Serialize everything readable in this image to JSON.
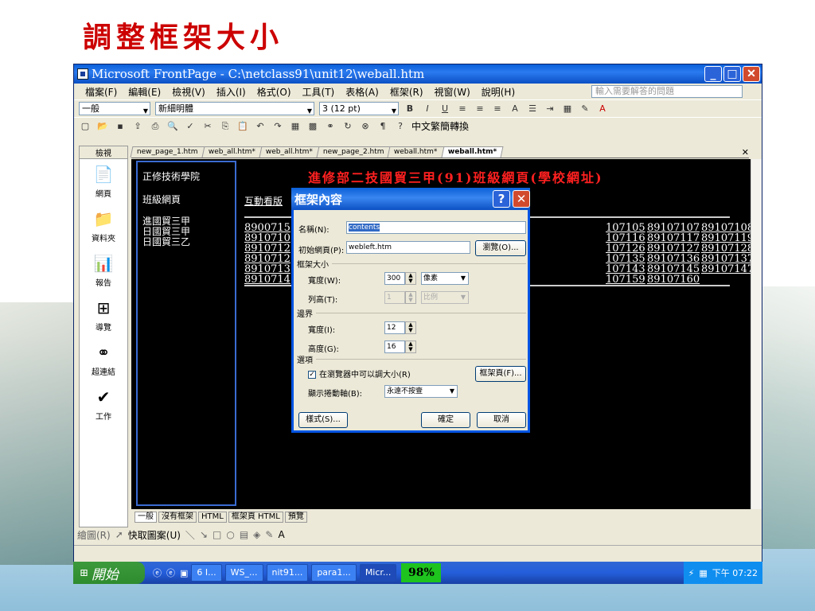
{
  "slide": {
    "title": "調整框架大小"
  },
  "window": {
    "title": "Microsoft FrontPage - C:\\netclass91\\unit12\\weball.htm"
  },
  "menu": {
    "items": [
      "檔案(F)",
      "編輯(E)",
      "檢視(V)",
      "插入(I)",
      "格式(O)",
      "工具(T)",
      "表格(A)",
      "框架(R)",
      "視窗(W)",
      "說明(H)"
    ],
    "help_placeholder": "輸入需要解答的問題"
  },
  "format_toolbar": {
    "style": "一般",
    "font": "新細明體",
    "size": "3 (12 pt)"
  },
  "std_toolbar": {
    "convert": "中文繁簡轉換"
  },
  "views": {
    "header": "檢視",
    "items": [
      "網頁",
      "資料夾",
      "報告",
      "導覽",
      "超連結",
      "工作"
    ]
  },
  "doc_tabs": [
    "new_page_1.htm",
    "web_all.htm*",
    "web_all.htm*",
    "new_page_2.htm",
    "weball.htm*",
    "weball.htm*"
  ],
  "page": {
    "left_links": [
      "正修技術學院",
      "班級網頁",
      "進國貿三甲",
      "日國貿三甲",
      "日國貿三乙"
    ],
    "heading": "進修部二技國貿三甲(91)班級網頁(學校網址)",
    "interactive_label": "互動看版",
    "ids_left": [
      "8900715",
      "8910710",
      "8910712",
      "8910712",
      "8910713",
      "8910714"
    ],
    "ids_c1": [
      "107105",
      "107116",
      "107126",
      "107135",
      "107143",
      "107159"
    ],
    "ids_c2": [
      "89107107",
      "89107117",
      "89107127",
      "89107136",
      "89107145",
      "89107160"
    ],
    "ids_c3": [
      "89107108",
      "89107119",
      "89107128",
      "89107137",
      "89107147",
      ""
    ]
  },
  "bottom_tabs": [
    "一般",
    "沒有框架",
    "HTML",
    "框架頁 HTML",
    "預覽"
  ],
  "drawing": {
    "draw": "繪圖(R)",
    "autoshapes": "快取圖案(U)"
  },
  "dialog": {
    "title": "框架內容",
    "name_label": "名稱(N):",
    "name_value": "contents",
    "page_label": "初始網頁(P):",
    "page_value": "webleft.htm",
    "browse": "瀏覽(O)...",
    "size_section": "框架大小",
    "width_label": "寬度(W):",
    "width_value": "300",
    "width_unit": "像素",
    "rows_label": "列高(T):",
    "rows_value": "1",
    "rows_unit": "比例",
    "margin_section": "邊界",
    "mwidth_label": "寬度(I):",
    "mwidth_value": "12",
    "mheight_label": "高度(G):",
    "mheight_value": "16",
    "options_section": "選項",
    "resize_label": "在瀏覽器中可以調大小(R)",
    "frames_page": "框架頁(F)...",
    "scroll_label": "顯示捲動軸(B):",
    "scroll_value": "永遠不按壹",
    "style": "樣式(S)...",
    "ok": "確定",
    "cancel": "取消"
  },
  "taskbar": {
    "start": "開始",
    "tasks": [
      "6 I...",
      "WS_...",
      "nit91...",
      "para1...",
      "Micr..."
    ],
    "battery": "98%",
    "clock": "下午 07:22"
  }
}
